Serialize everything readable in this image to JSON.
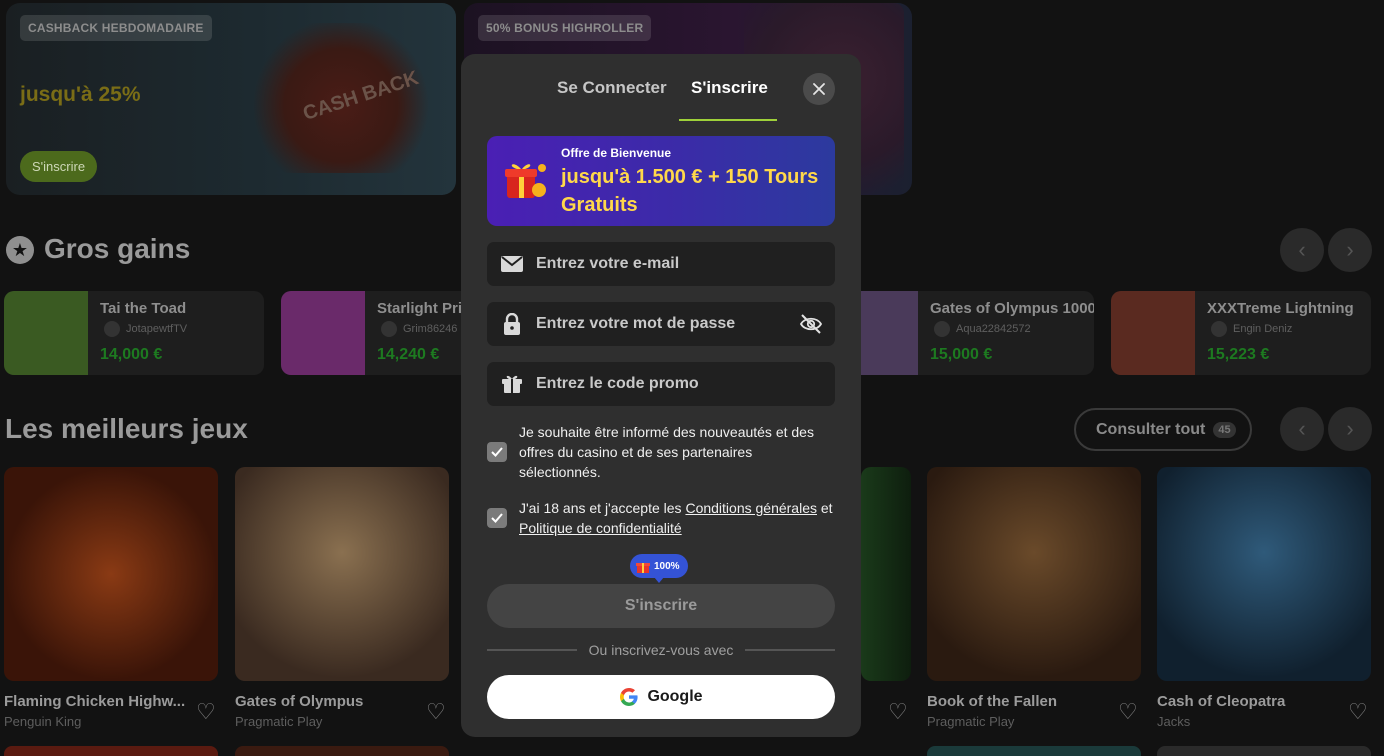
{
  "promos": [
    {
      "tag": "CASHBACK HEBDOMADAIRE",
      "title": "jusqu'à 25%",
      "button": "S'inscrire",
      "art_text": "CASH BACK"
    },
    {
      "tag": "50% BONUS HIGHROLLER"
    }
  ],
  "big_wins": {
    "title": "Gros gains",
    "items": [
      {
        "game": "Tai the Toad",
        "user": "JotapewtfTV",
        "amount": "14,000 €",
        "color": "#3a5a22"
      },
      {
        "game": "Starlight Pri",
        "user": "Grim86246",
        "amount": "14,240 €",
        "color": "#6a2a6a"
      },
      {
        "game": "Gates of Olympus 1000",
        "user": "Aqua22842572",
        "amount": "15,000 €",
        "color": "#4a3a5a"
      },
      {
        "game": "XXXTreme Lightning",
        "user": "Engin Deniz",
        "amount": "15,223 €",
        "color": "#5a2a20"
      }
    ]
  },
  "best_games": {
    "title": "Les meilleurs jeux",
    "see_all": "Consulter tout",
    "count": "45",
    "items": [
      {
        "title": "Flaming Chicken Highw...",
        "provider": "Penguin King",
        "color": "#6a2410"
      },
      {
        "title": "Gates of Olympus",
        "provider": "Pragmatic Play",
        "color": "#7a5a3a"
      },
      {
        "title": "Book of the Fallen",
        "provider": "Pragmatic Play",
        "color": "#5a3a20"
      },
      {
        "title": "Cash of Cleopatra",
        "provider": "Jacks",
        "color": "#1f3c5c"
      }
    ]
  },
  "modal": {
    "tab_login": "Se Connecter",
    "tab_signup": "S'inscrire",
    "welcome_small": "Offre de Bienvenue",
    "welcome_big": "jusqu'à 1.500 € + 150 Tours Gratuits",
    "email_placeholder": "Entrez votre e-mail",
    "password_placeholder": "Entrez votre mot de passe",
    "promo_placeholder": "Entrez le code promo",
    "newsletter_text": "Je souhaite être informé des nouveautés et des offres du casino et de ses partenaires sélectionnés.",
    "terms_prefix": "J'ai 18 ans et j'accepte les ",
    "terms_link": "Conditions générales",
    "terms_and": " et ",
    "privacy_link": "Politique de confidentialité",
    "bonus_badge": "100%",
    "submit": "S'inscrire",
    "divider": "Ou inscrivez-vous avec",
    "google": "Google"
  },
  "colors": {
    "accent": "#9fd13a",
    "welcome_gold": "#ffd84a",
    "win_green": "#1d7a20"
  }
}
